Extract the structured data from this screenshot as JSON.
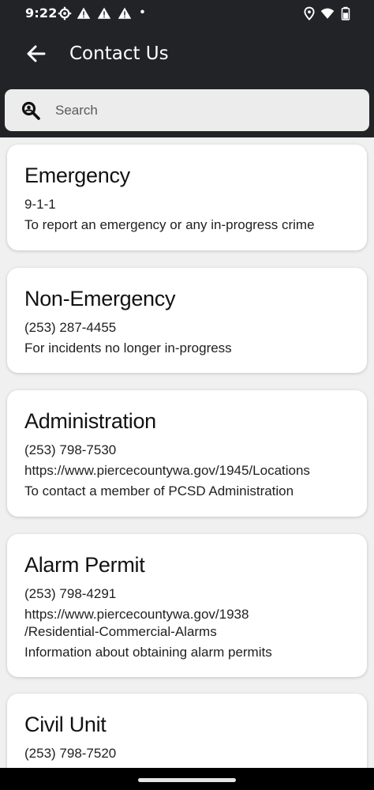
{
  "status_bar": {
    "time": "9:22",
    "icons": [
      "settings-gear-icon",
      "warning-icon",
      "warning-icon",
      "warning-icon",
      "dot-icon",
      "location-icon",
      "wifi-icon",
      "battery-icon"
    ]
  },
  "app_bar": {
    "title": "Contact Us",
    "back_icon": "arrow-left-icon"
  },
  "search": {
    "placeholder": "Search",
    "value": ""
  },
  "contacts": [
    {
      "name": "Emergency",
      "phone": "9-1-1",
      "description": "To report an emergency or any in-progress crime"
    },
    {
      "name": "Non-Emergency",
      "phone": "(253) 287-4455",
      "description": "For incidents no longer in-progress"
    },
    {
      "name": "Administration",
      "phone": "(253) 798-7530",
      "url": "https://www.piercecountywa.gov/1945/Locations",
      "description": "To contact a member of PCSD Administration"
    },
    {
      "name": "Alarm Permit",
      "phone": "(253) 798-4291",
      "url_line1": "https://www.piercecountywa.gov/1938",
      "url_line2": "/Residential-Commercial-Alarms",
      "description": "Information about obtaining alarm permits"
    },
    {
      "name": "Civil Unit",
      "phone": "(253) 798-7520"
    }
  ],
  "colors": {
    "header_bg": "#222327",
    "page_bg": "#f0f0f0",
    "card_bg": "#ffffff",
    "search_bg": "#ececec"
  }
}
